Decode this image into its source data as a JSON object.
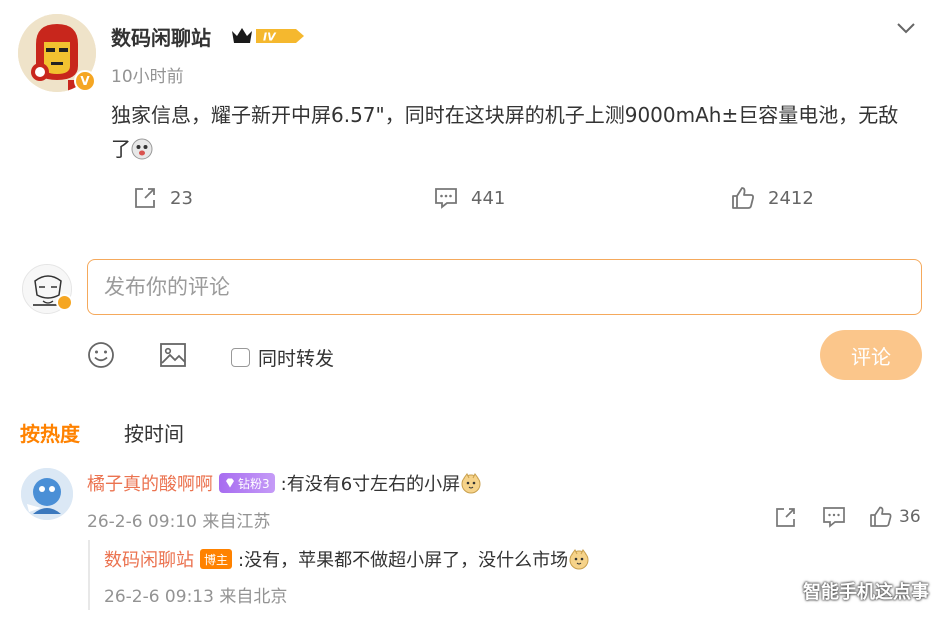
{
  "post": {
    "author": "数码闲聊站",
    "level": "IV",
    "time": "10小时前",
    "text": "独家信息，耀子新开中屏6.57\"，同时在这块屏的机子上测9000mAh±巨容量电池，无敌了",
    "text_emoji": "doge-emoji"
  },
  "actions": {
    "repost_count": "23",
    "comment_count": "441",
    "like_count": "2412"
  },
  "composer": {
    "placeholder": "发布你的评论",
    "repost_label": "同时转发",
    "submit_label": "评论"
  },
  "sort": {
    "hot_label": "按热度",
    "time_label": "按时间"
  },
  "comments": [
    {
      "user": "橘子真的酸啊啊",
      "fan_badge": "钻粉3",
      "text": ":有没有6寸左右的小屏",
      "meta": "26-2-6 09:10 来自江苏",
      "like_count": "36",
      "reply": {
        "user": "数码闲聊站",
        "badge": "博主",
        "text": ":没有，苹果都不做超小屏了，没什么市场",
        "meta": "26-2-6 09:13 来自北京"
      }
    }
  ],
  "watermark": "智能手机这点事",
  "colors": {
    "accent": "#ff8200",
    "username": "#eb7350",
    "submit_bg": "#fbc68b",
    "input_border": "#f5a95c",
    "meta": "#939393"
  }
}
